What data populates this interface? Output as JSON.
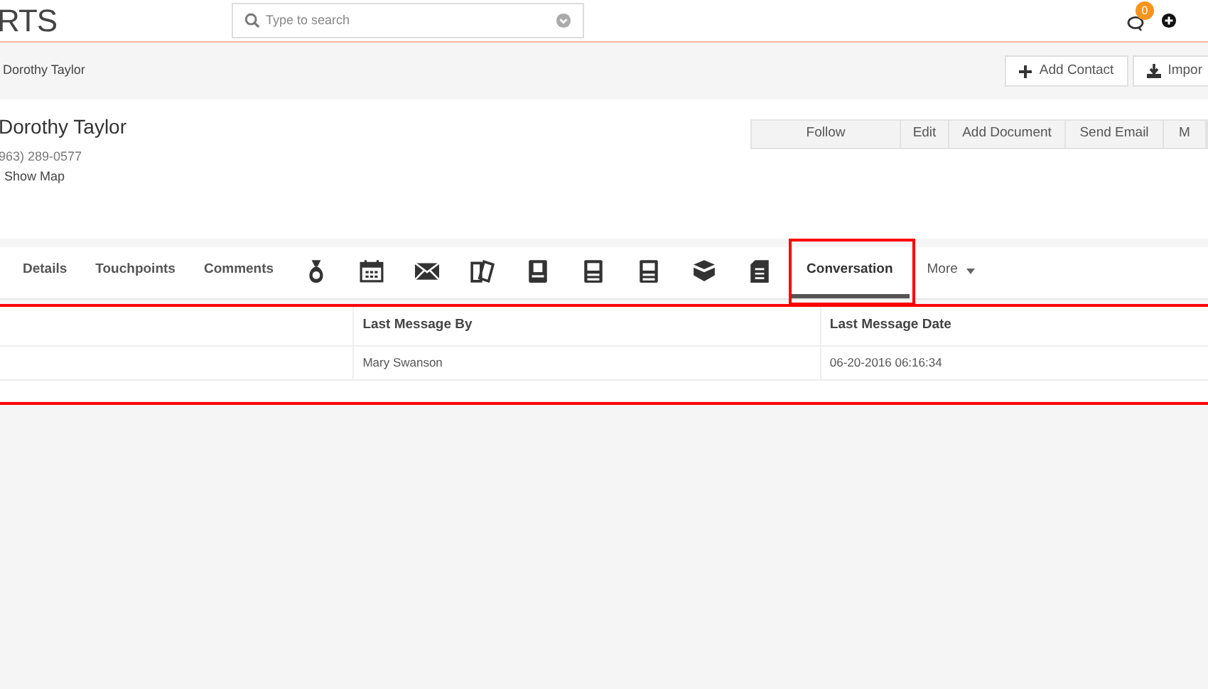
{
  "logo": "RTS",
  "search": {
    "placeholder": "Type to search"
  },
  "notifications": {
    "count": "0"
  },
  "breadcrumb": "Dorothy Taylor",
  "header_buttons": [
    "Add Contact",
    "Impor"
  ],
  "contact": {
    "name": "Dorothy Taylor",
    "phone": "963) 289-0577",
    "map_link": "Show Map"
  },
  "actions": [
    "Follow",
    "Edit",
    "Add Document",
    "Send Email",
    "M"
  ],
  "tabs": [
    {
      "kind": "text",
      "label": "Details",
      "selected": false
    },
    {
      "kind": "text",
      "label": "Touchpoints",
      "selected": false
    },
    {
      "kind": "text",
      "label": "Comments",
      "selected": false
    },
    {
      "kind": "icon",
      "selected": false
    },
    {
      "kind": "icon",
      "selected": false
    },
    {
      "kind": "icon",
      "selected": false
    },
    {
      "kind": "icon",
      "selected": false
    },
    {
      "kind": "icon",
      "selected": false
    },
    {
      "kind": "icon",
      "selected": false
    },
    {
      "kind": "icon",
      "selected": false
    },
    {
      "kind": "icon",
      "selected": false
    },
    {
      "kind": "icon",
      "selected": false
    },
    {
      "kind": "text",
      "label": "Conversation",
      "selected": true
    },
    {
      "kind": "dropdown",
      "label": "More",
      "selected": false
    }
  ],
  "table": {
    "columns": [
      "Last Message By",
      "Last Message Date"
    ],
    "rows": [
      [
        "Mary Swanson",
        "06-20-2016 06:16:34"
      ]
    ]
  }
}
